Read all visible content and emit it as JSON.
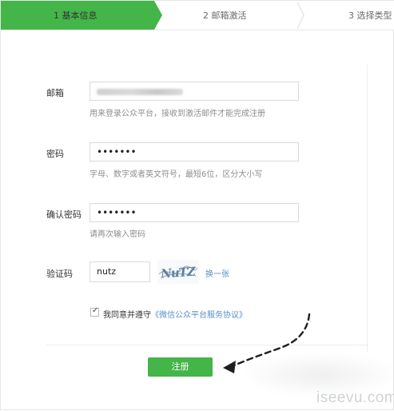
{
  "steps": [
    {
      "label": "1 基本信息",
      "active": true
    },
    {
      "label": "2 邮箱激活",
      "active": false
    },
    {
      "label": "3 选择类型",
      "active": false
    }
  ],
  "form": {
    "email": {
      "label": "邮箱",
      "hint": "用来登录公众平台，接收到激活邮件才能完成注册"
    },
    "password": {
      "label": "密码",
      "value": "•••••••",
      "hint": "字母、数字或者英文符号，最短6位，区分大小写"
    },
    "confirm": {
      "label": "确认密码",
      "value": "•••••••",
      "hint": "请再次输入密码"
    },
    "captcha": {
      "label": "验证码",
      "value": "nutz",
      "image_text": "NuTZ",
      "refresh_label": "换一张"
    },
    "agreement": {
      "checked": true,
      "text": "我同意并遵守",
      "link": "《微信公众平台服务协议》"
    },
    "submit_label": "注册"
  },
  "colors": {
    "primary": "#44b549",
    "link": "#5a8dc7",
    "hint": "#8d8d8d"
  },
  "watermark": "iseevu.com"
}
